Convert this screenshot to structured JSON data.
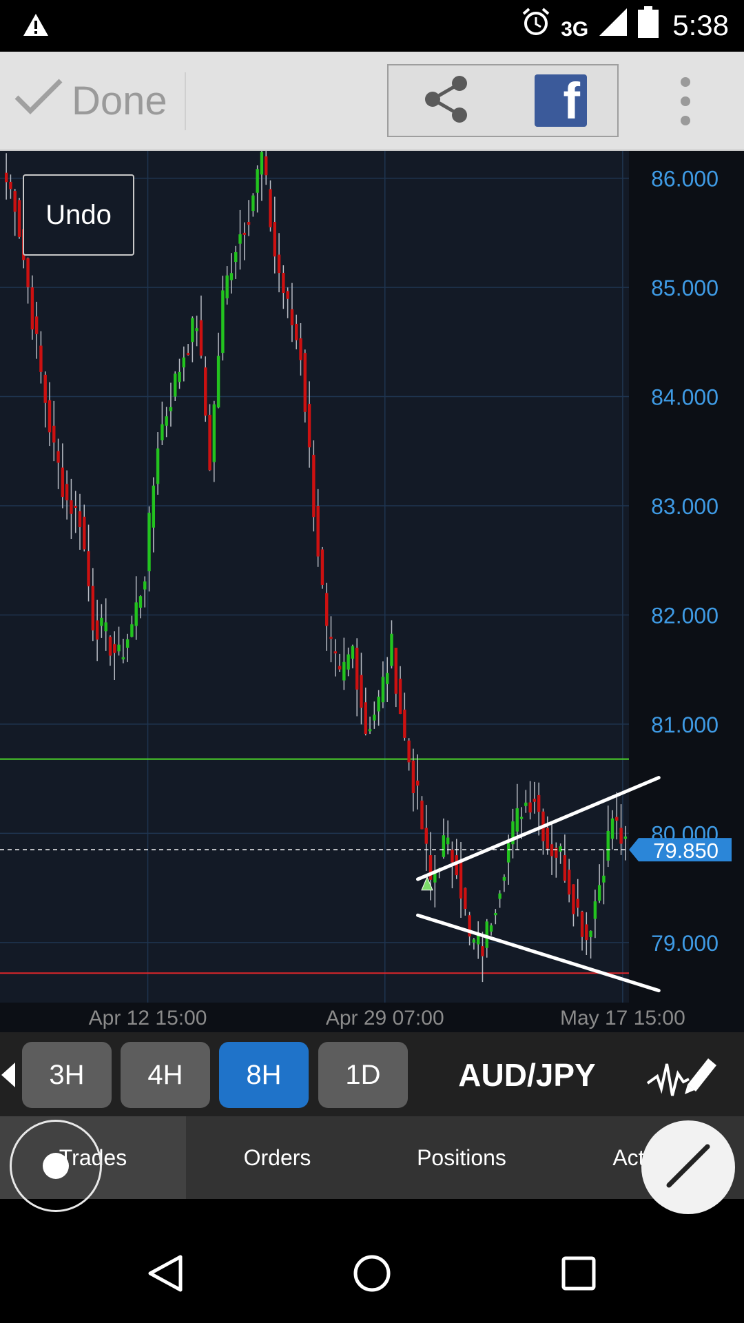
{
  "status_bar": {
    "network": "3G",
    "time": "5:38",
    "icons": [
      "warning-icon",
      "alarm-icon",
      "signal-icon",
      "battery-icon"
    ]
  },
  "toolbar": {
    "done_label": "Done",
    "icons": [
      "check-icon",
      "share-icon",
      "facebook-icon",
      "more-vert-icon"
    ]
  },
  "chart": {
    "undo_label": "Undo",
    "current_price": "79.850",
    "colors": {
      "background": "#131a26",
      "bull": "#23c31f",
      "bear": "#cc1111",
      "grid": "#1f3550",
      "axis_text": "#3f9be5",
      "price_tag": "#2b86d8",
      "support": "#e0262a",
      "resistance": "#4fd92a"
    }
  },
  "chart_data": {
    "type": "candlestick",
    "symbol": "AUD/JPY",
    "interval": "8H",
    "y_ticks": [
      "86.000",
      "85.000",
      "84.000",
      "83.000",
      "82.000",
      "81.000",
      "80.000",
      "79.000"
    ],
    "x_ticks": [
      "Apr 12 15:00",
      "Apr 29 07:00",
      "May 17 15:00"
    ],
    "ylim": [
      78.45,
      86.25
    ],
    "current_price": 79.85,
    "horizontal_lines": [
      {
        "price": 80.68,
        "color": "#4fd92a"
      },
      {
        "price": 78.72,
        "color": "#e0262a"
      }
    ],
    "trend_lines": [
      {
        "from": [
          0.5,
          79.58
        ],
        "to": [
          0.79,
          80.51
        ]
      },
      {
        "from": [
          0.5,
          79.25
        ],
        "to": [
          0.79,
          78.56
        ]
      }
    ],
    "close_path": [
      86.05,
      85.8,
      85.0,
      84.2,
      83.5,
      83.05,
      82.9,
      81.95,
      81.8,
      81.6,
      81.9,
      82.4,
      83.6,
      84.0,
      84.4,
      84.7,
      83.4,
      84.9,
      85.4,
      85.7,
      86.2,
      85.3,
      84.8,
      84.4,
      83.0,
      81.8,
      81.4,
      81.7,
      80.95,
      81.2,
      81.7,
      80.85,
      80.3,
      79.55,
      79.9,
      79.75,
      79.0,
      78.95,
      79.4,
      79.9,
      80.25,
      80.35,
      79.9,
      79.8,
      79.4,
      79.05,
      79.55,
      80.15,
      79.85
    ]
  },
  "timeframes": [
    {
      "label": "3H",
      "active": false
    },
    {
      "label": "4H",
      "active": false
    },
    {
      "label": "8H",
      "active": true
    },
    {
      "label": "1D",
      "active": false
    }
  ],
  "symbol_label": "AUD/JPY",
  "tabs": [
    {
      "label": "Trades",
      "active": true
    },
    {
      "label": "Orders",
      "active": false
    },
    {
      "label": "Positions",
      "active": false
    },
    {
      "label": "Activity",
      "active": false
    }
  ]
}
